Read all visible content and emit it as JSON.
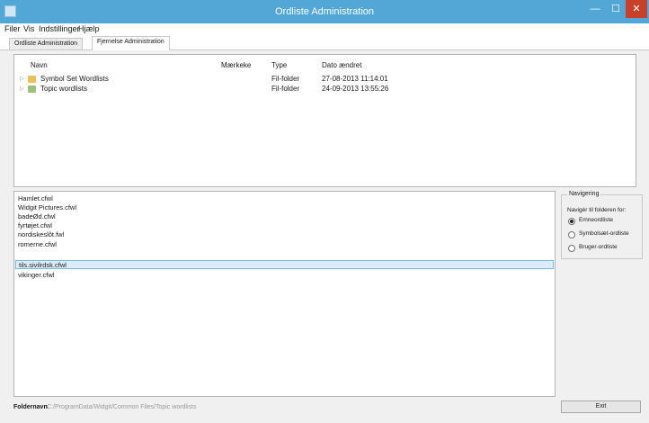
{
  "window": {
    "title": "Ordliste Administration",
    "min_glyph": "—",
    "max_glyph": "☐",
    "close_glyph": "✕"
  },
  "menu": {
    "items": [
      "Filer",
      "Vis",
      "Indstillinger",
      "Hjælp"
    ]
  },
  "tabs": [
    {
      "label": "Ordliste Administration",
      "active": false
    },
    {
      "label": "Fjernelse Administration",
      "active": true
    }
  ],
  "tree": {
    "columns": {
      "name": "Navn",
      "label": "Mærkeke",
      "type": "Type",
      "date": "Dato ændret"
    },
    "rows": [
      {
        "expander": "▷",
        "icon": "folder-icon",
        "name": "Symbol Set Wordlists",
        "label": "",
        "type": "Fil-folder",
        "date": "27-08-2013 11:14:01"
      },
      {
        "expander": "▷",
        "icon": "folder-icon",
        "name": "Topic wordlists",
        "label": "",
        "type": "Fil-folder",
        "date": "24-09-2013 13:55:26"
      }
    ]
  },
  "file_list": {
    "items": [
      "Hamlet.cfwl",
      "Widgit Pictures.cfwl",
      "badeØd.cfwl",
      "fyrtøjet.cfwl",
      "nordiskeslôt.fwl",
      "romerne.cfwl",
      "tils.sivilrdsk.cfwl",
      "vikinger.cfwl"
    ],
    "selected_index": 6
  },
  "navigation": {
    "title": "Navigering",
    "prompt": "Navigér til folderen for:",
    "options": [
      "Emneordliste",
      "Symbolsæt-ordliste",
      "Bruger-ordliste"
    ],
    "selected_index": 0
  },
  "status": {
    "label": "Foldernavn",
    "path": "C:/ProgramData/Widgit/Common Files/Topic wordlists"
  },
  "exit_button": {
    "label": "Exit"
  }
}
